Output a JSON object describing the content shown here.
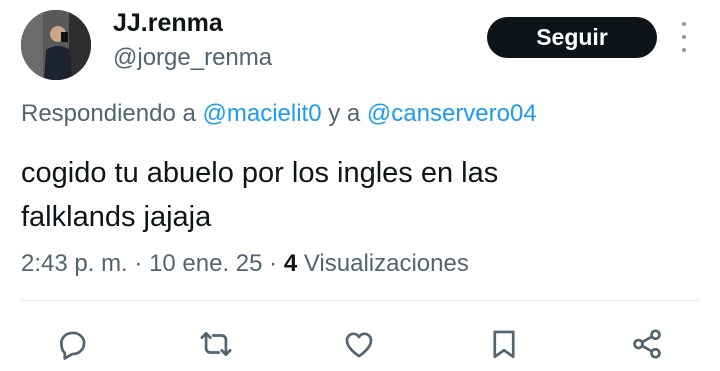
{
  "user": {
    "display_name": "JJ.renma",
    "handle": "@jorge_renma",
    "follow_label": "Seguir"
  },
  "reply": {
    "prefix": "Respondiendo a ",
    "mention1": "@macielit0",
    "connector": " y a ",
    "mention2": "@canservero04"
  },
  "tweet": {
    "text_line1": "cogido tu abuelo por los ingles en las",
    "text_line2": "falklands jajaja"
  },
  "meta": {
    "time": "2:43 p. m.",
    "date": "10 ene. 25",
    "views_count": "4",
    "views_label": "Visualizaciones",
    "separator": " · "
  },
  "actions": {
    "icons": [
      "reply-icon",
      "retweet-icon",
      "like-icon",
      "bookmark-icon",
      "share-icon"
    ]
  },
  "colors": {
    "accent": "#1d9bf0",
    "text": "#0f1419",
    "secondary": "#536471",
    "button_bg": "#0f1419"
  }
}
